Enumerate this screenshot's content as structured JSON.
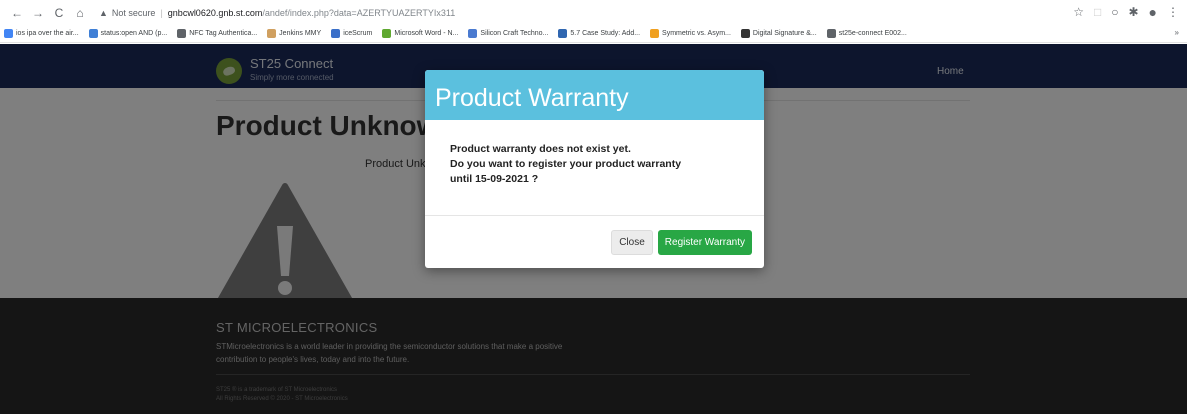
{
  "browser": {
    "insecure_label": "Not secure",
    "url_host": "gnbcwl0620.gnb.st.com",
    "url_path": "/andef/index.php?data=AZERTYUAZERTYIx311",
    "bookmarks": [
      {
        "label": "ios ipa over the air...",
        "color": "#4285f4"
      },
      {
        "label": "status:open AND (p...",
        "color": "#3f7fd6"
      },
      {
        "label": "NFC Tag Authentica...",
        "color": "#5f6368"
      },
      {
        "label": "Jenkins MMY",
        "color": "#d0a060"
      },
      {
        "label": "iceScrum",
        "color": "#3a6fc9"
      },
      {
        "label": "Microsoft Word - N...",
        "color": "#5fa830"
      },
      {
        "label": "Silicon Craft Techno...",
        "color": "#4a7ad0"
      },
      {
        "label": "5.7 Case Study: Add...",
        "color": "#2f66b0"
      },
      {
        "label": "Symmetric vs. Asym...",
        "color": "#f0a020"
      },
      {
        "label": "Digital Signature &...",
        "color": "#333333"
      },
      {
        "label": "st25e-connect E002...",
        "color": "#5f6368"
      }
    ],
    "more_label": "»"
  },
  "header": {
    "brand_title": "ST25 Connect",
    "brand_subtitle": "Simply more connected",
    "home_label": "Home"
  },
  "content": {
    "title": "Product Unknow",
    "text": "Product Unk"
  },
  "footer": {
    "title": "ST MICROELECTRONICS",
    "text": "STMicroelectronics is a world leader in providing the semiconductor solutions that make a positive contribution to people's lives, today and into the future.",
    "small_1": "ST25 ® is a trademark of ST Microelectronics",
    "small_2": "All Rights Reserved © 2020 - ST Microelectronics"
  },
  "modal": {
    "title": "Product Warranty",
    "line1": "Product warranty does not exist yet.",
    "line2": "Do you want to register your product warranty",
    "line3": "until 15-09-2021 ?",
    "close_label": "Close",
    "register_label": "Register Warranty"
  },
  "colors": {
    "header_bg": "#1b2b5a",
    "modal_header": "#5bc0de",
    "register_button": "#28a745"
  }
}
